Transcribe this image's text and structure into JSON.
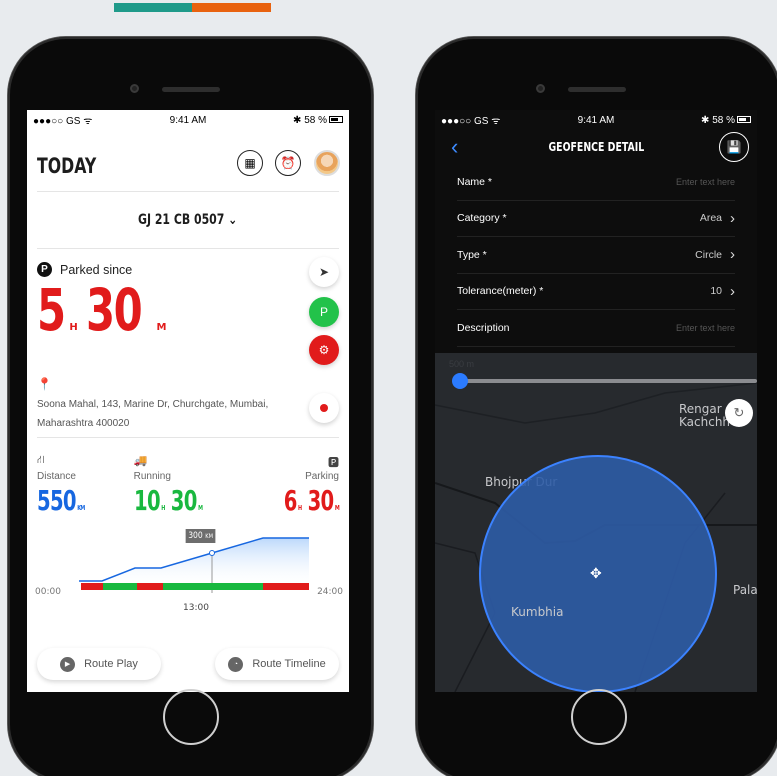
{
  "left_phone": {
    "status": {
      "carrier": "●●●○○ GS ᯤ",
      "time": "9:41 AM",
      "battery": "✱ 58 %"
    },
    "header": {
      "title": "TODAY",
      "icons": [
        "calendar-icon",
        "alarm-icon",
        "avatar"
      ]
    },
    "vehicle": {
      "label": "GJ 21 CB 0507 ⌄"
    },
    "parked": {
      "label": "Parked since",
      "hours": "5",
      "hours_unit": "H",
      "minutes": "30",
      "minutes_unit": "M"
    },
    "address": "Soona Mahal, 143, Marine Dr, Churchgate, Mumbai, Maharashtra 400020",
    "stats": {
      "distance": {
        "label": "Distance",
        "value": "550",
        "unit": "KM"
      },
      "running": {
        "label": "Running",
        "hours": "10",
        "hours_unit": "H",
        "minutes": "30",
        "minutes_unit": "M"
      },
      "parking": {
        "label": "Parking",
        "hours": "6",
        "hours_unit": "H",
        "minutes": "30",
        "minutes_unit": "M"
      }
    },
    "chart": {
      "tag_value": "300",
      "tag_unit": "KM",
      "start": "00:00",
      "end": "24:00",
      "marker": "13:00"
    },
    "actions": {
      "route_play": "Route Play",
      "route_timeline": "Route Timeline"
    }
  },
  "right_phone": {
    "status": {
      "carrier": "●●●○○ GS ᯤ",
      "time": "9:41 AM",
      "battery": "✱ 58 %"
    },
    "nav": {
      "title": "GEOFENCE DETAIL"
    },
    "form": {
      "name_label": "Name *",
      "name_placeholder": "Enter text here",
      "category_label": "Category *",
      "category_value": "Area",
      "type_label": "Type *",
      "type_value": "Circle",
      "tolerance_label": "Tolerance(meter) *",
      "tolerance_value": "10",
      "description_label": "Description",
      "description_placeholder": "Enter text here"
    },
    "map": {
      "slider_label": "500 m",
      "labels": [
        "Rengar Kachchh",
        "Bhojpur Dur",
        "Kumbhia",
        "Palas"
      ]
    }
  },
  "colors": {
    "accent_teal": "#1f9a8a",
    "accent_orange": "#e8620f",
    "red": "#e11b1b",
    "green": "#19b83f",
    "blue": "#1767e0"
  }
}
